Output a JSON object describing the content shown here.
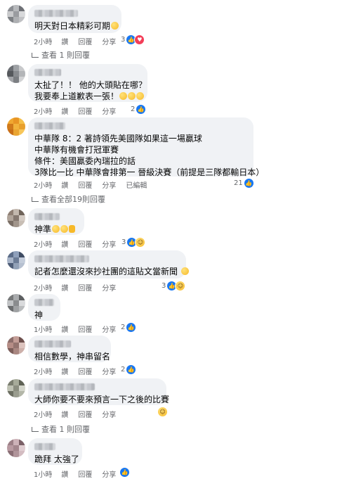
{
  "colors": {
    "bubble": "#f0f2f5",
    "meta": "#65676b",
    "like": "#1877f2",
    "love": "#f33e58",
    "haha": "#f7b928"
  },
  "action_labels": {
    "like": "讚",
    "reply": "回覆",
    "share": "分享",
    "edited": "已編輯"
  },
  "comments": [
    {
      "text_lines": [
        "明天對日本精彩可期"
      ],
      "time": "2小時",
      "reaction_count": "3",
      "reactions": [
        "like-icon",
        "love-icon"
      ],
      "view_replies": "查看 1 則回覆"
    },
    {
      "text_lines": [
        "太扯了！！ 他的大頭貼在哪？",
        "我要奉上道歉表一張！"
      ],
      "time": "2小時",
      "reaction_count": "2",
      "reactions": [
        "like-icon"
      ]
    },
    {
      "text_lines": [
        "中華隊 8：2 著詩領先美國隊如果這一場贏球",
        "中華隊有機會打冠軍賽",
        "條件：美國贏委內瑞拉的話",
        "3隊比一比 中華隊會排第一 晉級決賽（前提是三隊都輸日本）"
      ],
      "time": "2小時",
      "reaction_count": "21",
      "reactions": [
        "like-icon"
      ],
      "view_replies": "查看全部19則回覆"
    },
    {
      "text_lines": [
        "神準"
      ],
      "time": "2小時",
      "reaction_count": "3",
      "reactions": [
        "like-icon",
        "haha-icon"
      ]
    },
    {
      "text_lines": [
        "記者怎麼還沒來抄社團的這貼文當新聞"
      ],
      "time": "2小時",
      "reaction_count": "3",
      "reactions": [
        "like-icon",
        "haha-icon"
      ]
    },
    {
      "text_lines": [
        "神"
      ],
      "time": "1小時",
      "reaction_count": "2",
      "reactions": [
        "like-icon"
      ]
    },
    {
      "text_lines": [
        "相信數學，神串留名"
      ],
      "time": "2小時",
      "reaction_count": "2",
      "reactions": [
        "like-icon"
      ]
    },
    {
      "text_lines": [
        "大師你要不要來預言一下之後的比賽"
      ],
      "time": "2小時",
      "reaction_count": "",
      "reactions": [
        "haha-icon"
      ],
      "view_replies": "查看 1 則回覆"
    },
    {
      "text_lines": [
        "跪拜 太強了"
      ],
      "time": "1小時",
      "reaction_count": "",
      "reactions": [
        "like-icon"
      ]
    }
  ]
}
